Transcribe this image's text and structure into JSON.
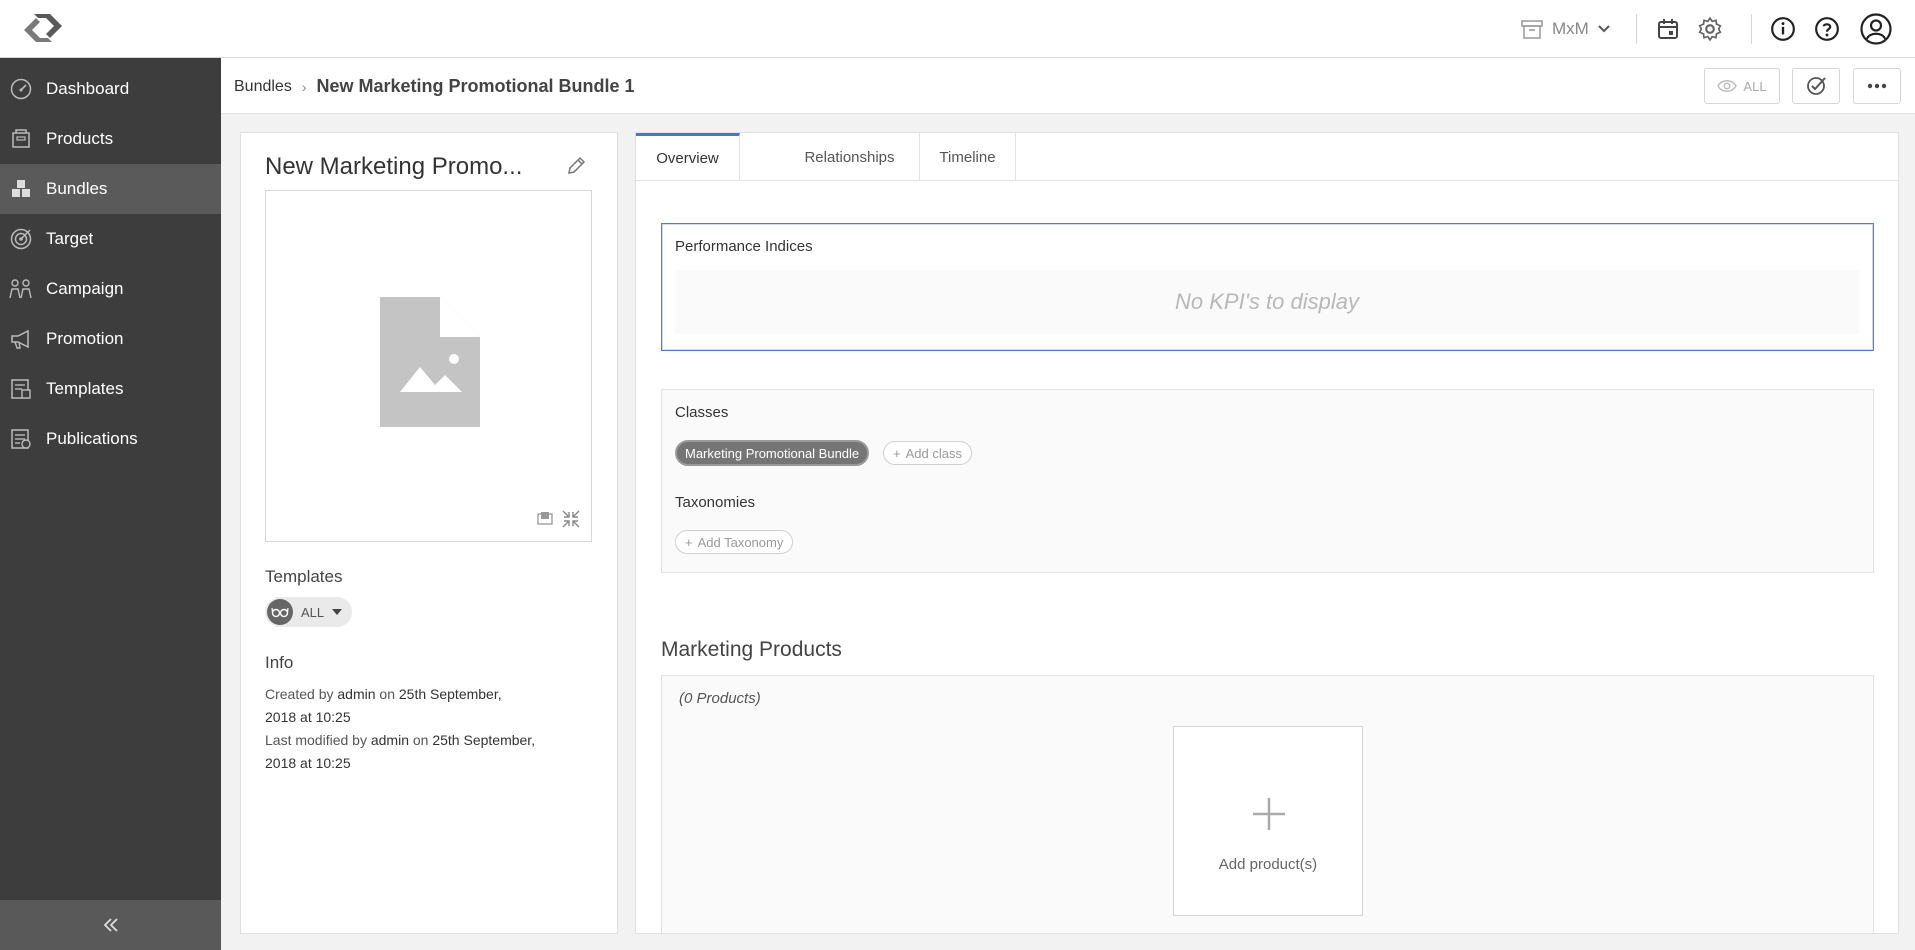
{
  "topbar": {
    "workspace_label": "MxM"
  },
  "sidebar": {
    "items": [
      {
        "label": "Dashboard",
        "icon": "dashboard-icon"
      },
      {
        "label": "Products",
        "icon": "products-icon"
      },
      {
        "label": "Bundles",
        "icon": "bundles-icon",
        "active": true
      },
      {
        "label": "Target",
        "icon": "target-icon"
      },
      {
        "label": "Campaign",
        "icon": "campaign-icon"
      },
      {
        "label": "Promotion",
        "icon": "promotion-icon"
      },
      {
        "label": "Templates",
        "icon": "templates-icon"
      },
      {
        "label": "Publications",
        "icon": "publications-icon"
      }
    ],
    "collapse_icon": "double-chevron-left-icon"
  },
  "header": {
    "breadcrumb_parent": "Bundles",
    "breadcrumb_current": "New Marketing Promotional Bundle 1",
    "view_filter_label": "ALL"
  },
  "left_panel": {
    "title": "New Marketing Promo...",
    "templates_label": "Templates",
    "template_selected": "ALL",
    "info_label": "Info",
    "created": {
      "prefix": "Created by",
      "user": "admin",
      "on": "on",
      "date": "25th September,",
      "at": "2018 at 10:25"
    },
    "modified": {
      "prefix": "Last modified by",
      "user": "admin",
      "on": "on",
      "date": "25th September,",
      "at": "2018 at 10:25"
    }
  },
  "tabs": [
    {
      "label": "Overview",
      "active": true
    },
    {
      "label": "Relationships"
    },
    {
      "label": "Timeline"
    }
  ],
  "performance": {
    "title": "Performance Indices",
    "empty_text": "No KPI's to display"
  },
  "classes": {
    "title": "Classes",
    "chips": [
      "Marketing Promotional Bundle"
    ],
    "add_class_label": "Add class",
    "taxonomies_title": "Taxonomies",
    "add_taxonomy_label": "Add Taxonomy"
  },
  "marketing_products": {
    "title": "Marketing Products",
    "count_text": "(0 Products)",
    "add_label": "Add product(s)"
  },
  "colors": {
    "sidebar_bg": "#3d3d3d",
    "sidebar_active": "#5a5a5a",
    "accent": "#3a7bd5",
    "chip_bg": "#757575"
  }
}
